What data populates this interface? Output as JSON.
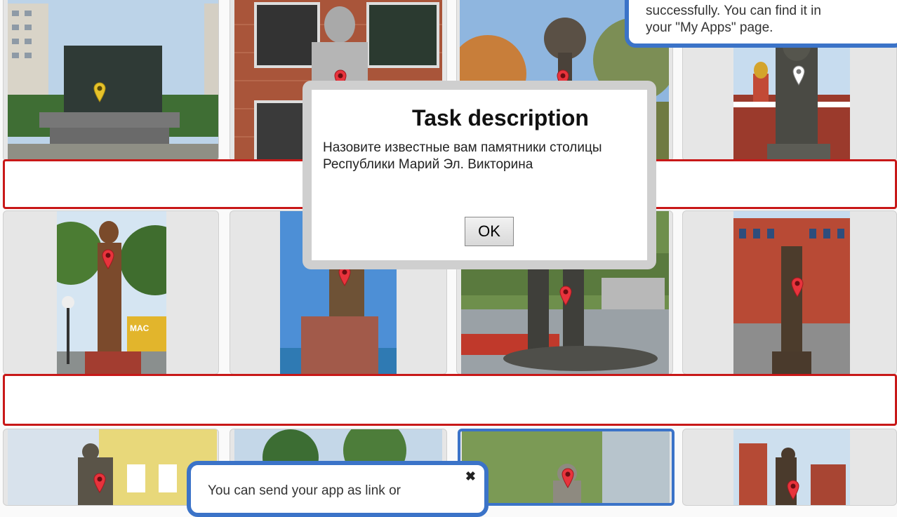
{
  "dialog": {
    "title": "Task description",
    "text": "Назовите известные вам памятники столицы Республики Марий Эл. Викторина",
    "ok_label": "OK"
  },
  "tips": {
    "top_line1": "successfully. You can find it in",
    "top_line2": "your \"My Apps\" page.",
    "bottom_text": "You can send your app as link or",
    "close_glyph": "✖"
  },
  "photos": {
    "bus_sign": "MAC"
  },
  "colors": {
    "pin_red": "#e8333c",
    "pin_yellow": "#e6c22a",
    "pin_white": "#ffffff",
    "bar_border": "#c81818",
    "accent_blue": "#3b73c8"
  }
}
